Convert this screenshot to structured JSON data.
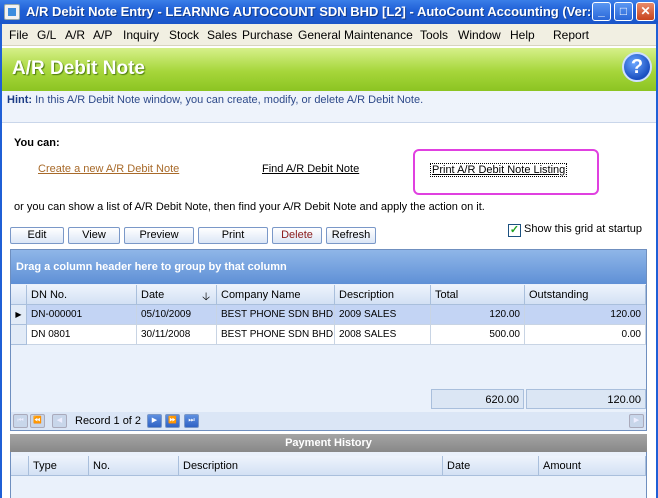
{
  "window": {
    "title": "A/R Debit Note Entry - LEARNNG AUTOCOUNT SDN BHD [L2] - AutoCount Accounting (Ver:...",
    "minimize": "_",
    "maximize": "□",
    "close": "✕"
  },
  "menu": [
    "File",
    "G/L",
    "A/R",
    "A/P",
    "Inquiry",
    "Stock",
    "Sales",
    "Purchase",
    "General Maintenance",
    "Tools",
    "Window",
    "Help",
    "Report"
  ],
  "header": {
    "title": "A/R Debit Note",
    "help_icon": "?"
  },
  "hint": {
    "label": "Hint:",
    "text": "In this A/R Debit Note window, you can create, modify, or delete A/R Debit Note."
  },
  "actions": {
    "you_can": "You can:",
    "create": "Create a new A/R Debit Note",
    "find": "Find A/R Debit Note",
    "print_listing": "Print A/R Debit Note Listing",
    "or_text": "or you can show a list of A/R Debit Note, then find your A/R Debit Note and apply the action on it."
  },
  "toolbar": {
    "edit": "Edit",
    "view": "View",
    "preview": "Preview",
    "print": "Print",
    "delete": "Delete",
    "refresh": "Refresh",
    "show_grid_label": "Show this grid at startup",
    "show_grid_checked": true
  },
  "grid": {
    "group_hint": "Drag a column header here to group by that column",
    "columns": [
      "DN No.",
      "Date",
      "Company Name",
      "Description",
      "Total",
      "Outstanding"
    ],
    "sort_indicator": "🡣",
    "rows": [
      {
        "dn": "DN-000001",
        "date": "05/10/2009",
        "company": "BEST PHONE SDN BHD",
        "description": "2009 SALES",
        "total": "120.00",
        "outstanding": "120.00"
      },
      {
        "dn": "DN 0801",
        "date": "30/11/2008",
        "company": "BEST PHONE SDN BHD",
        "description": "2008 SALES",
        "total": "500.00",
        "outstanding": "0.00"
      }
    ],
    "footer_total": "620.00",
    "footer_outstanding": "120.00",
    "record_text": "Record 1 of 2"
  },
  "payment_history": {
    "title": "Payment History",
    "columns": [
      "Type",
      "No.",
      "Description",
      "Date",
      "Amount"
    ]
  }
}
